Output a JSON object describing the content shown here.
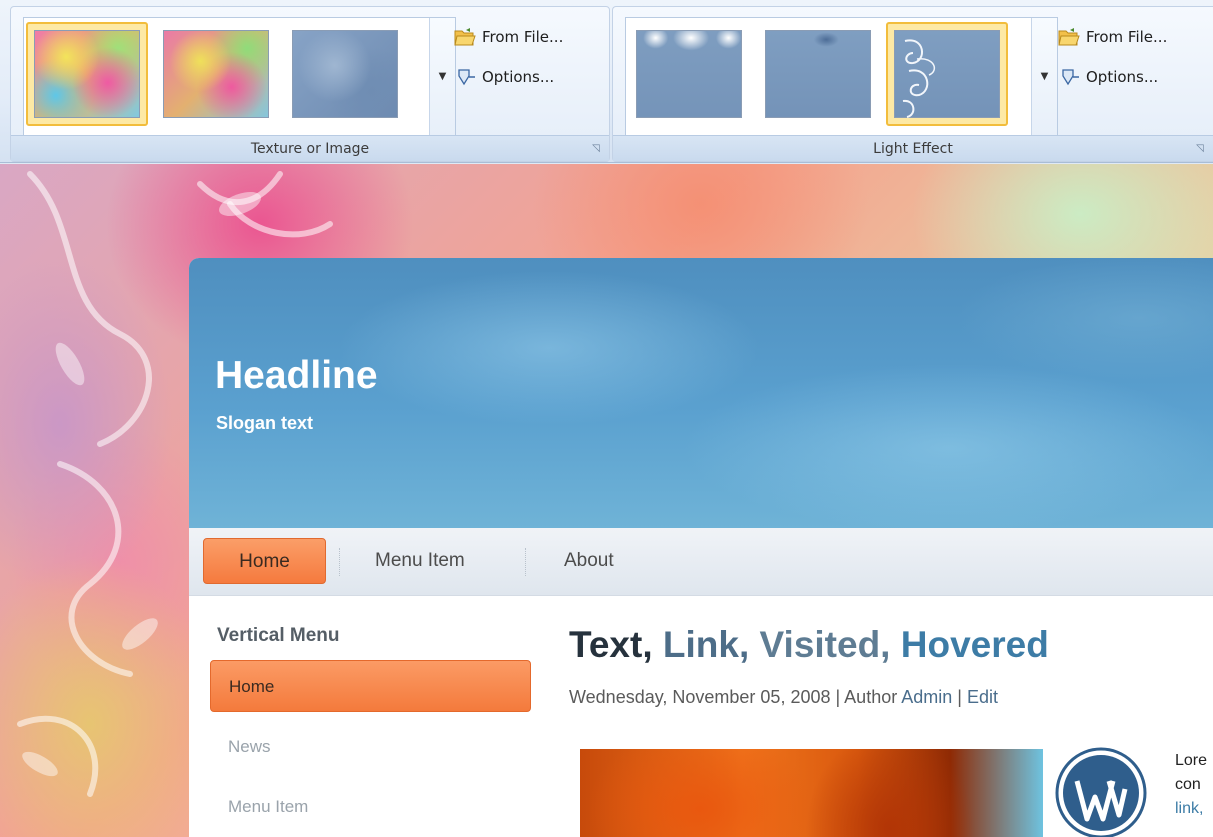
{
  "ribbon": {
    "texture_group": {
      "title": "Texture or Image",
      "from_file": "From File...",
      "options": "Options..."
    },
    "light_group": {
      "title": "Light Effect",
      "from_file": "From File...",
      "options": "Options..."
    }
  },
  "site": {
    "headline": "Headline",
    "slogan": "Slogan text",
    "nav": [
      "Home",
      "Menu Item",
      "About"
    ],
    "vertical_menu": {
      "title": "Vertical Menu",
      "items": [
        "Home",
        "News",
        "Menu Item"
      ]
    },
    "post": {
      "title_text": "Text, ",
      "title_link": "Link, ",
      "title_visited": "Visited, ",
      "title_hovered": "Hovered",
      "meta_date": "Wednesday, November 05, 2008 | Author ",
      "meta_author": "Admin",
      "meta_sep": " | ",
      "meta_edit": "Edit",
      "body_line1": "Lore",
      "body_line2": "con",
      "body_line3": "link,"
    }
  },
  "colors": {
    "accent_orange": "#f57a3e",
    "selected_border": "#f2bd3c",
    "header_blue": "#5aa0cf"
  }
}
